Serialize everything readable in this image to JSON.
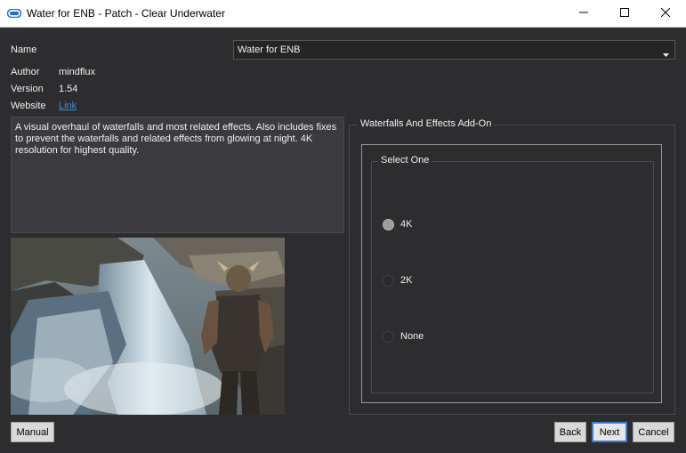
{
  "window": {
    "title": "Water for ENB - Patch - Clear Underwater",
    "icons": {
      "app": "app-logo-icon",
      "minimize": "minimize-icon",
      "maximize": "maximize-icon",
      "close": "close-icon"
    }
  },
  "info": {
    "name_label": "Name",
    "name_value": "Water for ENB",
    "author_label": "Author",
    "author_value": "mindflux",
    "version_label": "Version",
    "version_value": "1.54",
    "website_label": "Website",
    "website_link": "Link",
    "description": "A visual overhaul of waterfalls and most related effects. Also includes fixes to prevent the waterfalls and related effects from glowing at night. 4K resolution for highest quality."
  },
  "options": {
    "group_title": "Waterfalls And Effects Add-On",
    "select_title": "Select One",
    "choices": [
      {
        "label": "4K",
        "checked": true
      },
      {
        "label": "2K",
        "checked": false
      },
      {
        "label": "None",
        "checked": false
      }
    ]
  },
  "buttons": {
    "manual": "Manual",
    "back": "Back",
    "next": "Next",
    "cancel": "Cancel"
  },
  "colors": {
    "background": "#2d2d30",
    "link": "#3a8ee6",
    "accent": "#3b7ad6"
  }
}
